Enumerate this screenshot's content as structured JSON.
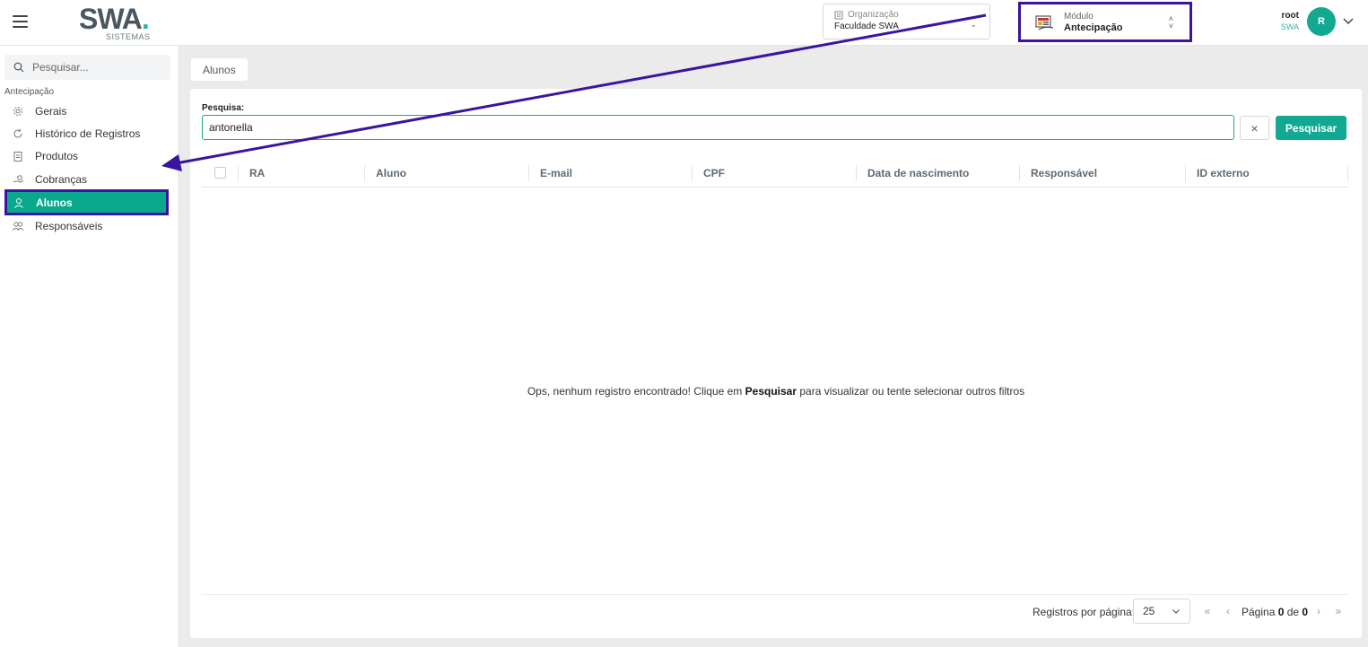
{
  "header": {
    "logo_text": "SWA",
    "logo_dot": ".",
    "logo_sub": "SISTEMAS",
    "organization": {
      "label": "Organização",
      "value": "Faculdade SWA"
    },
    "module": {
      "label": "Módulo",
      "value": "Antecipação"
    },
    "user": {
      "name": "root",
      "org": "SWA",
      "initial": "R"
    }
  },
  "sidebar": {
    "search_placeholder": "Pesquisar...",
    "section": "Antecipação",
    "items": [
      {
        "label": "Gerais",
        "icon": "gear-icon"
      },
      {
        "label": "Histórico de Registros",
        "icon": "history-icon"
      },
      {
        "label": "Produtos",
        "icon": "clipboard-icon"
      },
      {
        "label": "Cobranças",
        "icon": "money-hand-icon"
      },
      {
        "label": "Alunos",
        "icon": "user-icon",
        "active": true
      },
      {
        "label": "Responsáveis",
        "icon": "users-icon"
      }
    ]
  },
  "main": {
    "breadcrumb": "Alunos",
    "search_label": "Pesquisa:",
    "search_value": "antonella",
    "clear_label": "×",
    "search_button": "Pesquisar",
    "columns": [
      "RA",
      "Aluno",
      "E-mail",
      "CPF",
      "Data de nascimento",
      "Responsável",
      "ID externo"
    ],
    "empty_before": "Ops, nenhum registro encontrado! Clique em ",
    "empty_bold": "Pesquisar",
    "empty_after": " para visualizar ou tente selecionar outros filtros",
    "pager": {
      "per_page_label": "Registros por página:",
      "per_page_value": "25",
      "page_prefix": "Página ",
      "page_current": "0",
      "page_mid": " de ",
      "page_total": "0"
    }
  },
  "colors": {
    "accent": "#11a991",
    "highlight": "#3a149e"
  }
}
